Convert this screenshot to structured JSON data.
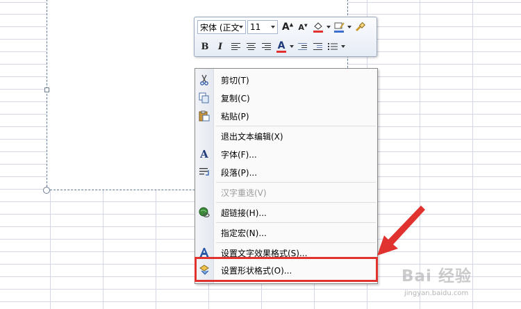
{
  "mini_toolbar": {
    "font_name": "宋体 (正文",
    "font_size": "11",
    "grow_font_label": "A",
    "shrink_font_label": "A",
    "bold_label": "B",
    "italic_label": "I",
    "font_color_label": "A",
    "icons": [
      "grow-font-icon",
      "shrink-font-icon",
      "fill-color-icon",
      "line-color-icon",
      "format-painter-icon",
      "align-left-icon",
      "align-center-icon",
      "align-right-icon",
      "decrease-indent-icon",
      "increase-indent-icon",
      "bullets-icon"
    ],
    "colors": {
      "fill_underline": "#e03030",
      "font_color": "#e03030",
      "line_underline": "#3a6fd0"
    }
  },
  "context_menu": {
    "items": [
      {
        "label": "剪切(T)",
        "icon": "scissors-icon",
        "enabled": true
      },
      {
        "label": "复制(C)",
        "icon": "copy-icon",
        "enabled": true
      },
      {
        "label": "粘贴(P)",
        "icon": "paste-icon",
        "enabled": true
      },
      {
        "label": "退出文本编辑(X)",
        "icon": "",
        "enabled": true
      },
      {
        "label": "字体(F)...",
        "icon": "font-icon",
        "enabled": true
      },
      {
        "label": "段落(P)...",
        "icon": "paragraph-icon",
        "enabled": true
      },
      {
        "label": "汉字重选(V)",
        "icon": "",
        "enabled": false
      },
      {
        "label": "超链接(H)...",
        "icon": "hyperlink-icon",
        "enabled": true
      },
      {
        "label": "指定宏(N)...",
        "icon": "",
        "enabled": true
      },
      {
        "label": "设置文字效果格式(S)...",
        "icon": "text-effects-icon",
        "enabled": true
      },
      {
        "label": "设置形状格式(O)...",
        "icon": "shape-format-icon",
        "enabled": true
      }
    ],
    "highlighted_item": "设置形状格式(O)...",
    "highlight_color": "#e0322e"
  },
  "watermark": {
    "brand": "Bai 经验",
    "url": "jingyan.baidu.com"
  }
}
